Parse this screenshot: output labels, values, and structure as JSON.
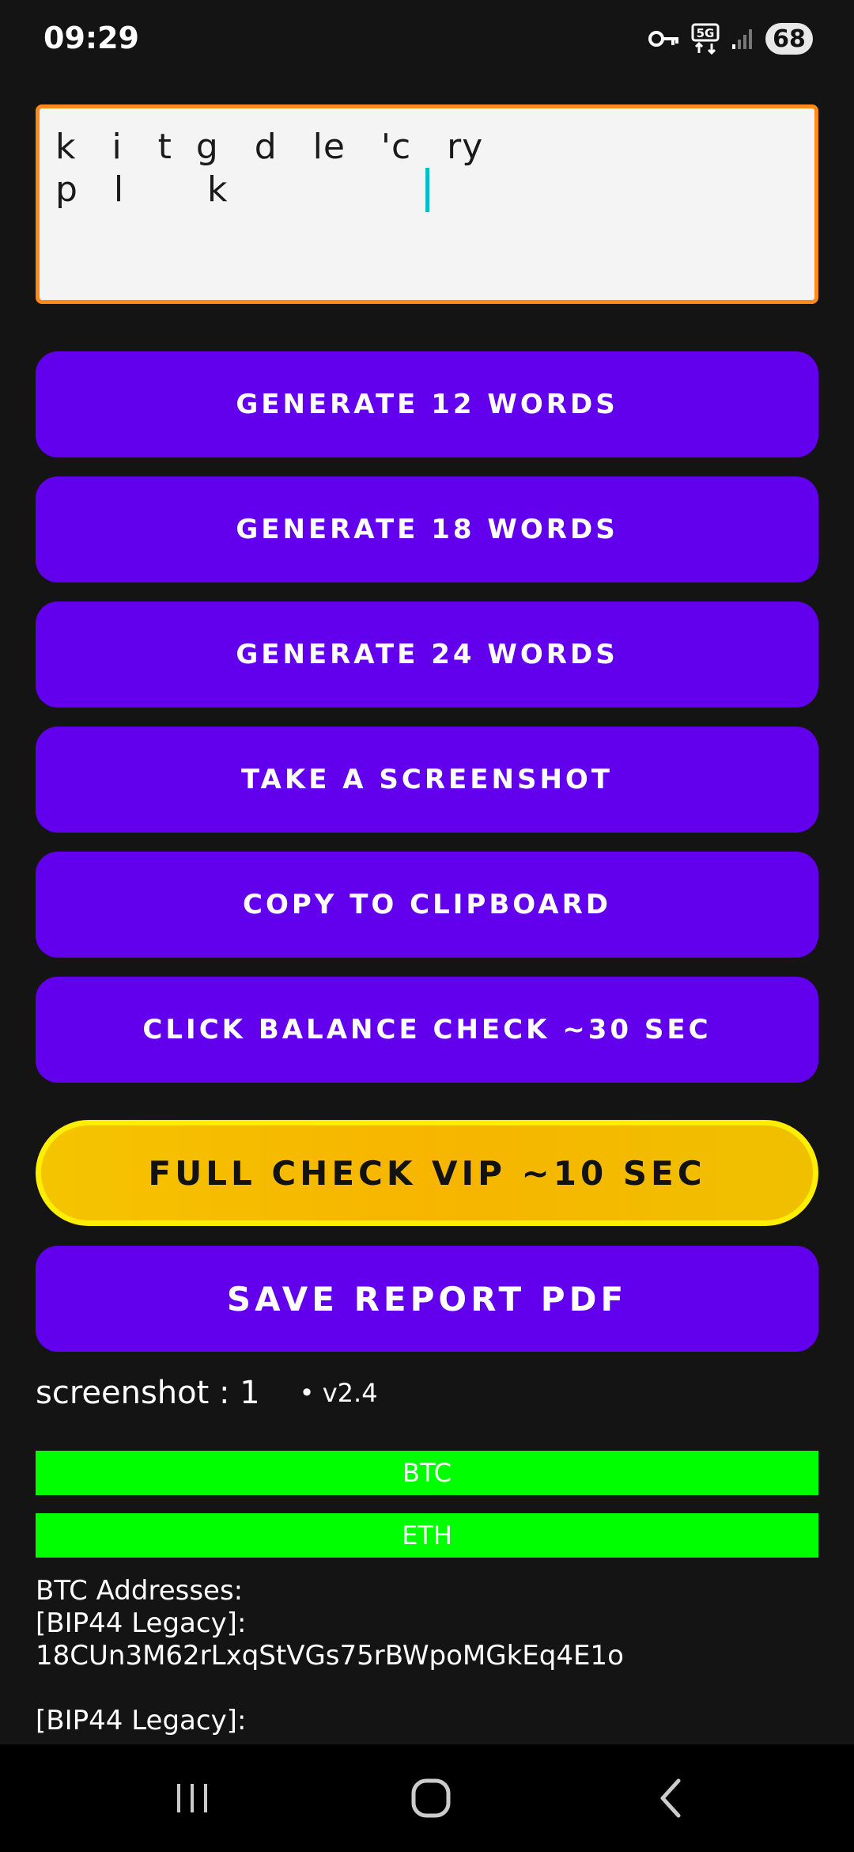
{
  "status_bar": {
    "time": "09:29",
    "network": "5G",
    "battery": "68"
  },
  "mnemonic": {
    "text": "k   i   t  g   d   le   'c   ry\np   l       k"
  },
  "buttons": {
    "gen12": "GENERATE 12 WORDS",
    "gen18": "GENERATE 18 WORDS",
    "gen24": "GENERATE 24 WORDS",
    "screenshot": "TAKE A SCREENSHOT",
    "copy": "COPY TO CLIPBOARD",
    "balance": "CLICK BALANCE CHECK ~30 SEC",
    "vip": "FULL CHECK VIP ~10 SEC",
    "pdf": "SAVE REPORT PDF"
  },
  "info": {
    "screenshot_count": "screenshot  : 1",
    "version": "• v2.4"
  },
  "coins": {
    "btc": "BTC",
    "eth": "ETH"
  },
  "addresses": {
    "text": "BTC Addresses:\n[BIP44 Legacy]:\n18CUn3M62rLxqStVGs75rBWpoMGkEq4E1o\n\n[BIP44 Legacy]:"
  },
  "colors": {
    "accent": "#6200ee",
    "vip": "#f7b500",
    "coin_bar": "#00ff00",
    "border": "#ff8a1a"
  }
}
